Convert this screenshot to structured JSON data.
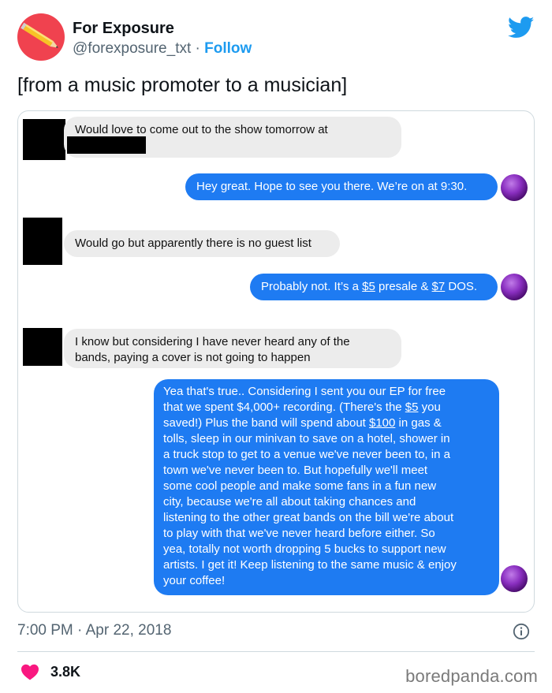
{
  "account": {
    "name": "For Exposure",
    "handle": "@forexposure_txt",
    "separator": " · ",
    "follow_label": "Follow"
  },
  "tweet": {
    "text": "[from a music promoter to a musician]",
    "timestamp": "7:00 PM · Apr 22, 2018",
    "likes": "3.8K"
  },
  "messages": {
    "m1": {
      "line1": "Would love to come out to the show tomorrow at"
    },
    "m2": {
      "text": "Hey great. Hope to see you there.  We’re on at 9:30."
    },
    "m3": {
      "text": "Would go but apparently there is no guest list"
    },
    "m4": {
      "a": "Probably not. It’s a ",
      "b": "$5",
      "c": " presale & ",
      "d": "$7",
      "e": " DOS."
    },
    "m5": {
      "line1": "I know but considering I have never heard any of the",
      "line2": "bands, paying a cover is not going to happen"
    },
    "m6": {
      "l1": "Yea that's true.. Considering I sent you our EP for free",
      "l2a": "that we spent $4,000+ recording. (There's the ",
      "l2b": "$5",
      "l2c": " you",
      "l3a": "saved!) Plus the band will spend about ",
      "l3b": "$100",
      "l3c": " in gas &",
      "l4": "tolls, sleep in our minivan to save on a hotel, shower in",
      "l5": "a truck stop to get to a venue we've never been to, in a",
      "l6": "town we've never been to. But hopefully we'll meet",
      "l7": "some cool people and make some fans in a fun new",
      "l8": "city, because we're all about taking chances and",
      "l9": "listening to the other great bands on the bill we're about",
      "l10": "to play with that we've never heard before either. So",
      "l11": "yea, totally not worth dropping 5 bucks to support new",
      "l12": "artists. I get it! Keep listening to the same music & enjoy",
      "l13": "your coffee!"
    }
  },
  "watermark": "boredpanda.com",
  "colors": {
    "accent": "#1d9bf0",
    "avatar_bg": "#f0424f",
    "outgoing_bubble": "#1e7bf2",
    "incoming_bubble": "#ececec",
    "heart": "#f91880"
  },
  "icons": [
    "pencil-icon",
    "twitter-bird-icon",
    "info-icon",
    "heart-icon"
  ]
}
